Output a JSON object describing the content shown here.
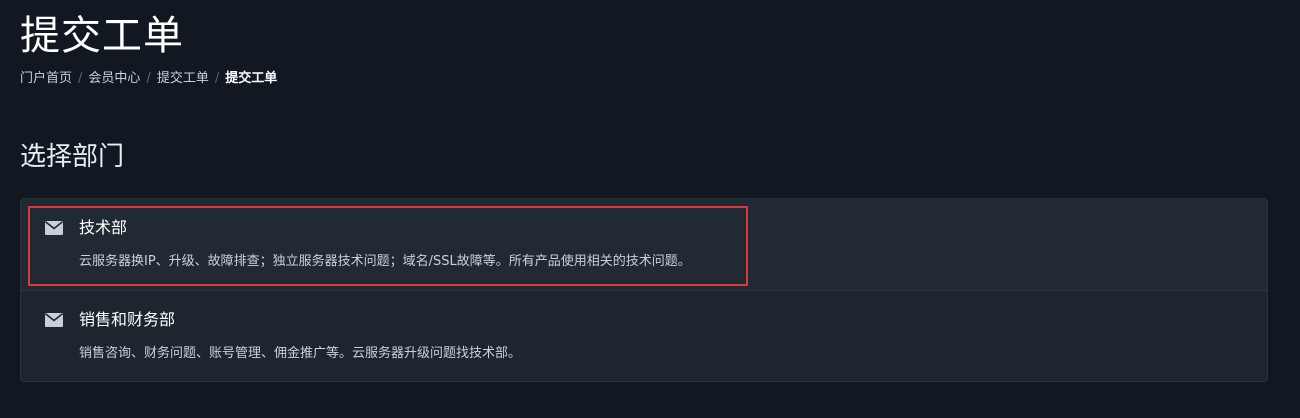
{
  "header": {
    "title": "提交工单"
  },
  "breadcrumb": [
    {
      "label": "门户首页"
    },
    {
      "label": "会员中心"
    },
    {
      "label": "提交工单"
    },
    {
      "label": "提交工单"
    }
  ],
  "breadcrumb_separator": "/",
  "section": {
    "title": "选择部门"
  },
  "departments": [
    {
      "icon": "envelope-icon",
      "name": "技术部",
      "description": "云服务器换IP、升级、故障排查；独立服务器技术问题；域名/SSL故障等。所有产品使用相关的技术问题。",
      "highlighted": true
    },
    {
      "icon": "envelope-icon",
      "name": "销售和财务部",
      "description": "销售咨询、财务问题、账号管理、佣金推广等。云服务器升级问题找技术部。",
      "highlighted": false
    }
  ],
  "colors": {
    "background": "#111821",
    "panel": "#1d252e",
    "highlight_border": "#e0383a",
    "text_primary": "#ffffff",
    "text_secondary": "#c9d1d9"
  }
}
